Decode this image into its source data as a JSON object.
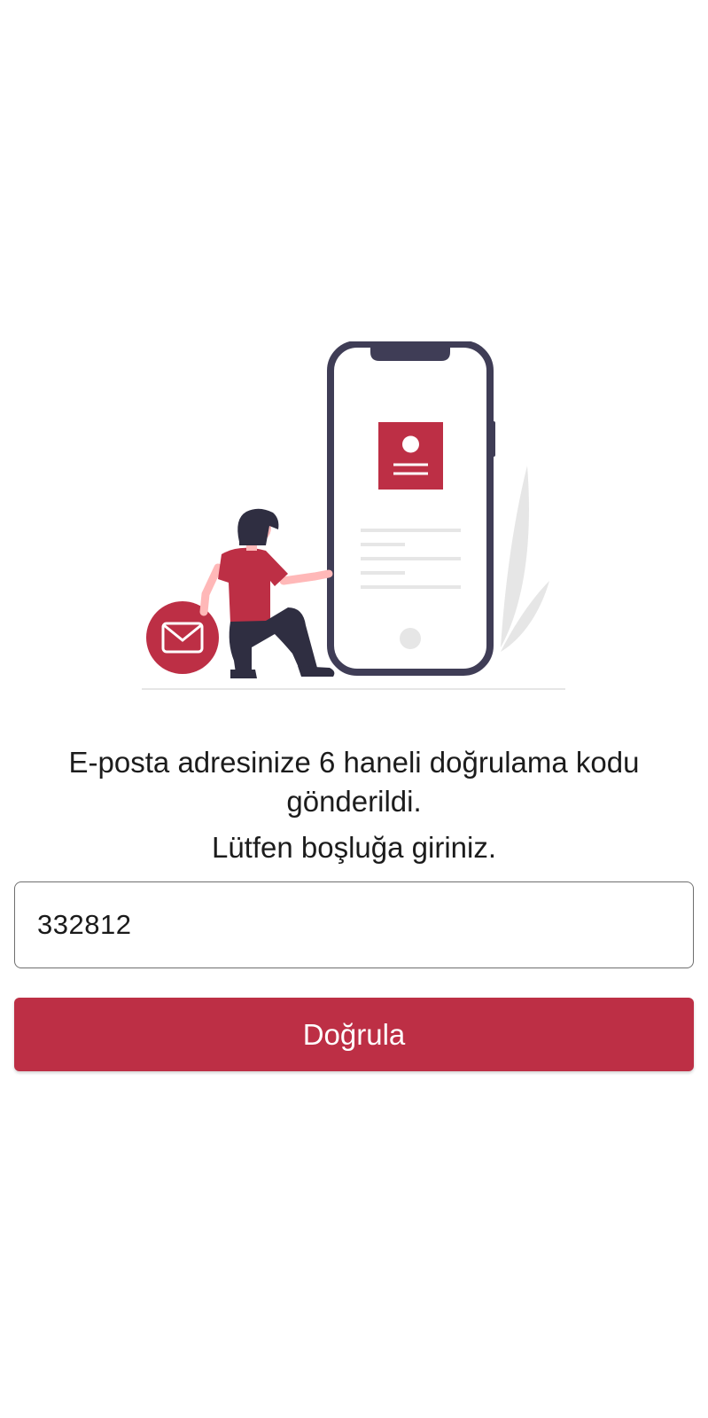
{
  "illustration": {
    "icon": "phone-verification-illustration",
    "accent_color": "#bd2f45",
    "outline_color": "#3f3d56"
  },
  "message": {
    "line1": "E-posta adresinize 6 haneli doğrulama kodu gönderildi.",
    "line2": "Lütfen boşluğa giriniz."
  },
  "code_input": {
    "value": "332812"
  },
  "verify_button": {
    "label": "Doğrula",
    "color": "#bd2f45"
  }
}
